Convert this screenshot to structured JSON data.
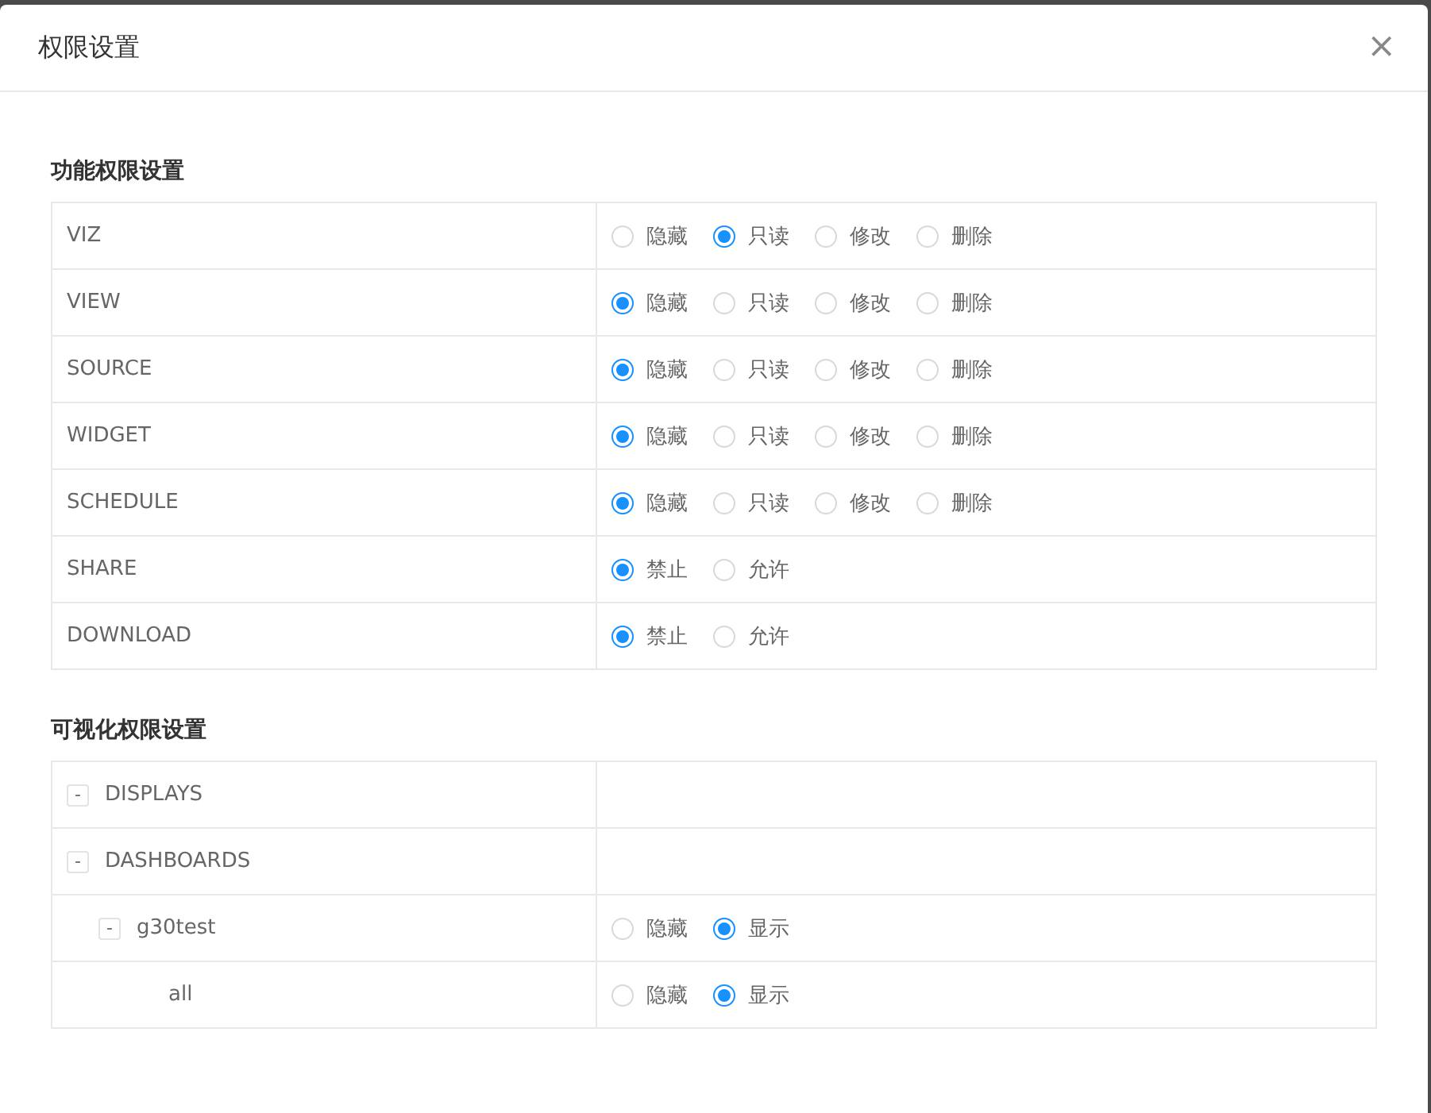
{
  "dialog": {
    "title": "权限设置",
    "close": "×"
  },
  "sections": [
    {
      "title": "功能权限设置",
      "kind": "flat",
      "rows": [
        {
          "label": "VIZ",
          "options": [
            {
              "label": "隐藏",
              "selected": false
            },
            {
              "label": "只读",
              "selected": true
            },
            {
              "label": "修改",
              "selected": false
            },
            {
              "label": "删除",
              "selected": false
            }
          ]
        },
        {
          "label": "VIEW",
          "options": [
            {
              "label": "隐藏",
              "selected": true
            },
            {
              "label": "只读",
              "selected": false
            },
            {
              "label": "修改",
              "selected": false
            },
            {
              "label": "删除",
              "selected": false
            }
          ]
        },
        {
          "label": "SOURCE",
          "options": [
            {
              "label": "隐藏",
              "selected": true
            },
            {
              "label": "只读",
              "selected": false
            },
            {
              "label": "修改",
              "selected": false
            },
            {
              "label": "删除",
              "selected": false
            }
          ]
        },
        {
          "label": "WIDGET",
          "options": [
            {
              "label": "隐藏",
              "selected": true
            },
            {
              "label": "只读",
              "selected": false
            },
            {
              "label": "修改",
              "selected": false
            },
            {
              "label": "删除",
              "selected": false
            }
          ]
        },
        {
          "label": "SCHEDULE",
          "options": [
            {
              "label": "隐藏",
              "selected": true
            },
            {
              "label": "只读",
              "selected": false
            },
            {
              "label": "修改",
              "selected": false
            },
            {
              "label": "删除",
              "selected": false
            }
          ]
        },
        {
          "label": "SHARE",
          "options": [
            {
              "label": "禁止",
              "selected": true
            },
            {
              "label": "允许",
              "selected": false
            }
          ]
        },
        {
          "label": "DOWNLOAD",
          "options": [
            {
              "label": "禁止",
              "selected": true
            },
            {
              "label": "允许",
              "selected": false
            }
          ]
        }
      ]
    },
    {
      "title": "可视化权限设置",
      "kind": "tree",
      "rows": [
        {
          "label": "DISPLAYS",
          "toggle": "-"
        },
        {
          "label": "DASHBOARDS",
          "toggle": "-",
          "children": [
            {
              "label": "g30test",
              "toggle": "-",
              "options": [
                {
                  "label": "隐藏",
                  "selected": false
                },
                {
                  "label": "显示",
                  "selected": true
                }
              ],
              "children": [
                {
                  "label": "all",
                  "options": [
                    {
                      "label": "隐藏",
                      "selected": false
                    },
                    {
                      "label": "显示",
                      "selected": true
                    }
                  ]
                }
              ]
            }
          ]
        }
      ]
    }
  ]
}
